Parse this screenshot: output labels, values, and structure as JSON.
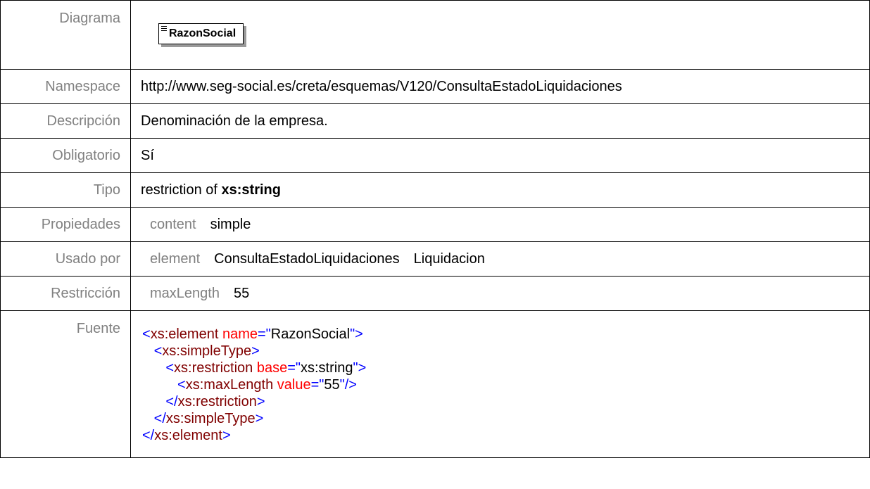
{
  "rows": {
    "diagram": {
      "label": "Diagrama",
      "element_name": "RazonSocial"
    },
    "namespace": {
      "label": "Namespace",
      "value": "http://www.seg-social.es/creta/esquemas/V120/ConsultaEstadoLiquidaciones"
    },
    "description": {
      "label": "Descripción",
      "value": "Denominación de la empresa."
    },
    "required": {
      "label": "Obligatorio",
      "value": "Sí"
    },
    "type": {
      "label": "Tipo",
      "prefix": "restriction of",
      "base": "xs:string"
    },
    "properties": {
      "label": "Propiedades",
      "key": "content",
      "value": "simple"
    },
    "used_by": {
      "label": "Usado por",
      "key": "element",
      "items": [
        "ConsultaEstadoLiquidaciones",
        "Liquidacion"
      ]
    },
    "restriction": {
      "label": "Restricción",
      "key": "maxLength",
      "value": "55"
    },
    "source": {
      "label": "Fuente",
      "l1_tag": "xs:element",
      "l1_attr": "name",
      "l1_val": "RazonSocial",
      "l2_tag": "xs:simpleType",
      "l3_tag": "xs:restriction",
      "l3_attr": "base",
      "l3_val": "xs:string",
      "l4_tag": "xs:maxLength",
      "l4_attr": "value",
      "l4_val": "55",
      "l5_tag": "xs:restriction",
      "l6_tag": "xs:simpleType",
      "l7_tag": "xs:element"
    }
  },
  "colors": {
    "label_gray": "#808080",
    "xml_tag": "#800000",
    "xml_punct": "#0000ff",
    "xml_attr": "#ff0000"
  }
}
